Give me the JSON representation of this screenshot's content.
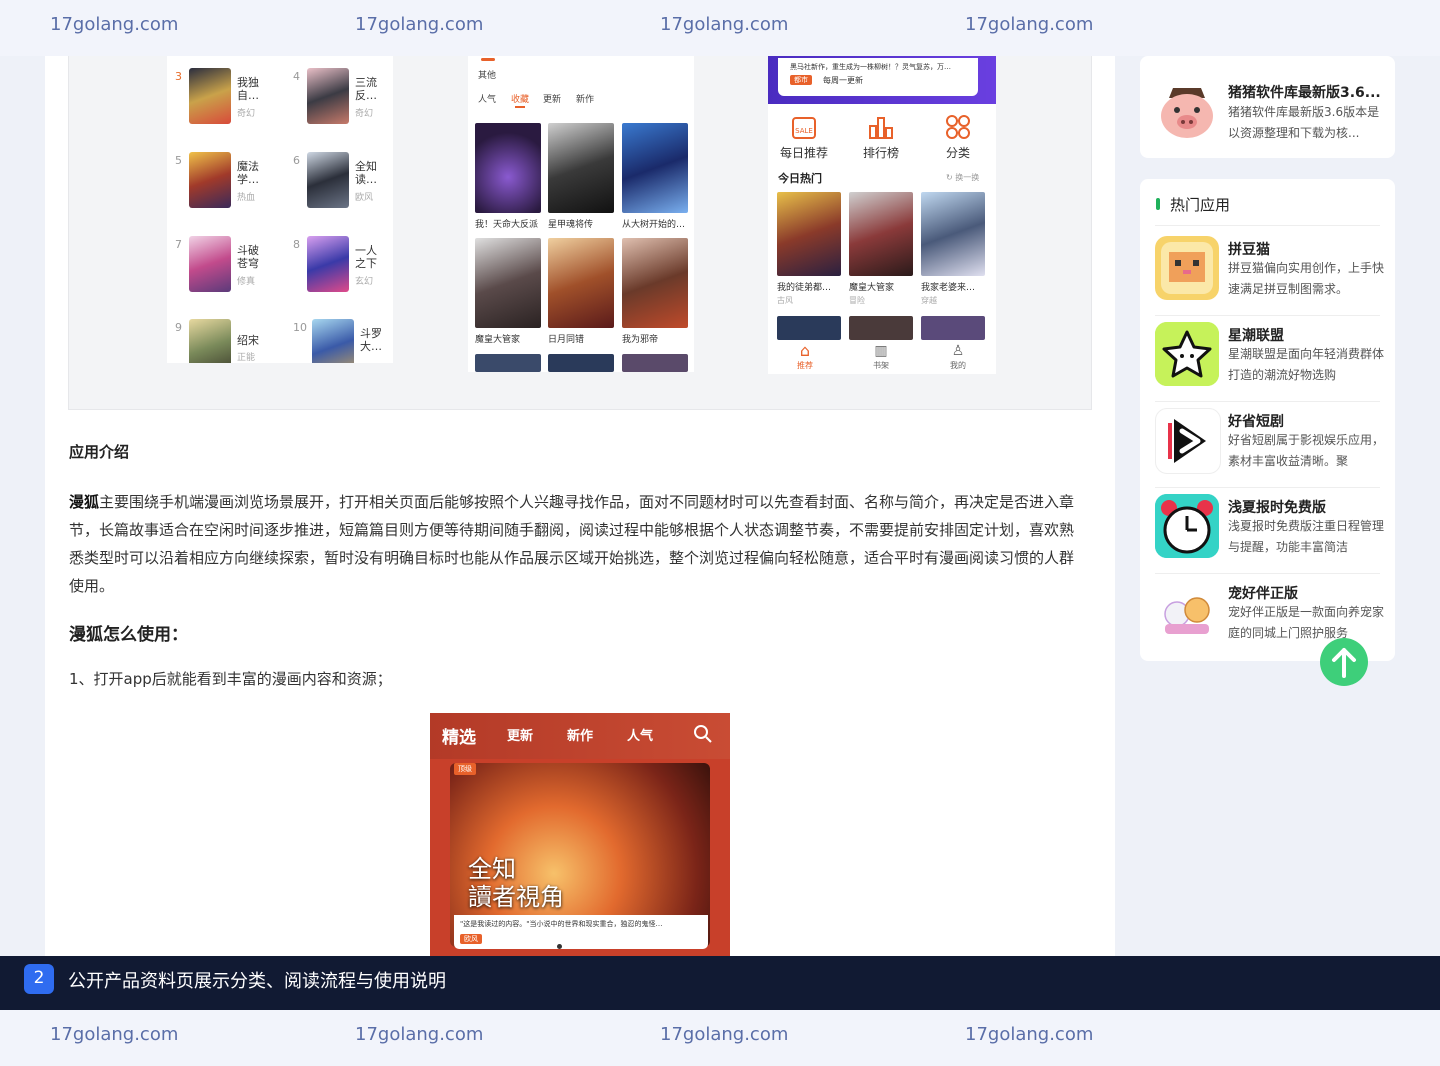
{
  "watermark": {
    "text": "17golang.com"
  },
  "gallery": {
    "shot1": {
      "items": [
        {
          "num": "3",
          "title": "我独自…",
          "tag": "奇幻",
          "title2": ""
        },
        {
          "num": "4",
          "title": "三流反…",
          "tag": "奇幻"
        },
        {
          "num": "5",
          "title": "魔法学…",
          "tag": "热血"
        },
        {
          "num": "6",
          "title": "全知读…",
          "tag": "欧风"
        },
        {
          "num": "7",
          "title": "斗破苍穹",
          "tag": "修真"
        },
        {
          "num": "8",
          "title": "一人之下",
          "tag": "玄幻"
        },
        {
          "num": "9",
          "title": "绍宋",
          "tag": "正能"
        },
        {
          "num": "10",
          "title": "斗罗大…",
          "tag": ""
        }
      ]
    },
    "shot2": {
      "other": "其他",
      "tabs": [
        "人气",
        "收藏",
        "更新",
        "新作"
      ],
      "captions_row1": [
        "我！天命大反派",
        "星甲魂将传",
        "从大树开始的…"
      ],
      "captions_row2": [
        "魔皇大管家",
        "日月同错",
        "我为邪帝"
      ]
    },
    "shot3": {
      "note_line1": "黑马社新作，重生成为一株柳树！？灵气复苏，万…",
      "note_badge": "都市",
      "note_line2": "每周一更新",
      "categories": [
        "每日推荐",
        "排行榜",
        "分类"
      ],
      "section": "今日热门",
      "refresh": "换一换",
      "captions": [
        "我的徒弟都…",
        "魔皇大管家",
        "我家老婆来…"
      ],
      "subs": [
        "古风",
        "冒险",
        "穿越"
      ],
      "nav": [
        "推荐",
        "书架",
        "我的"
      ]
    }
  },
  "content": {
    "section_title": "应用介绍",
    "para_bold": "漫狐",
    "para_text": "主要围绕手机端漫画浏览场景展开，打开相关页面后能够按照个人兴趣寻找作品，面对不同题材时可以先查看封面、名称与简介，再决定是否进入章节，长篇故事适合在空闲时间逐步推进，短篇篇目则方便等待期间随手翻阅，阅读过程中能够根据个人状态调整节奏，不需要提前安排固定计划，喜欢熟悉类型时可以沿着相应方向继续探索，暂时没有明确目标时也能从作品展示区域开始挑选，整个浏览过程偏向轻松随意，适合平时有漫画阅读习惯的人群使用。",
    "how_title": "漫狐怎么使用：",
    "step1": "1、打开app后就能看到丰富的漫画内容和资源；",
    "phone": {
      "tabs": [
        "精选",
        "更新",
        "新作",
        "人气"
      ],
      "badge": "顶级",
      "title_line1": "全知",
      "title_line2": "讀者視角",
      "strip_text": "\"这是我读过的内容。\"当小说中的世界和现实重合，独忍的鬼怪…",
      "strip_tag": "欧风"
    }
  },
  "sidebar": {
    "top_app": {
      "name": "猪猪软件库最新版3.6...",
      "desc": "猪猪软件库最新版3.6版本是以资源整理和下载为核..."
    },
    "hot_title": "热门应用",
    "apps": [
      {
        "name": "拼豆猫",
        "desc": "拼豆猫偏向实用创作，上手快速满足拼豆制图需求。"
      },
      {
        "name": "星潮联盟",
        "desc": "星潮联盟是面向年轻消费群体打造的潮流好物选购"
      },
      {
        "name": "好省短剧",
        "desc": "好省短剧属于影视娱乐应用，素材丰富收益清晰。聚"
      },
      {
        "name": "浅夏报时免费版",
        "desc": "浅夏报时免费版注重日程管理与提醒，功能丰富简洁"
      },
      {
        "name": "宠好伴正版",
        "desc": "宠好伴正版是一款面向养宠家庭的同城上门照护服务"
      }
    ]
  },
  "caption": {
    "num": "2",
    "text": "公开产品资料页展示分类、阅读流程与使用说明"
  }
}
